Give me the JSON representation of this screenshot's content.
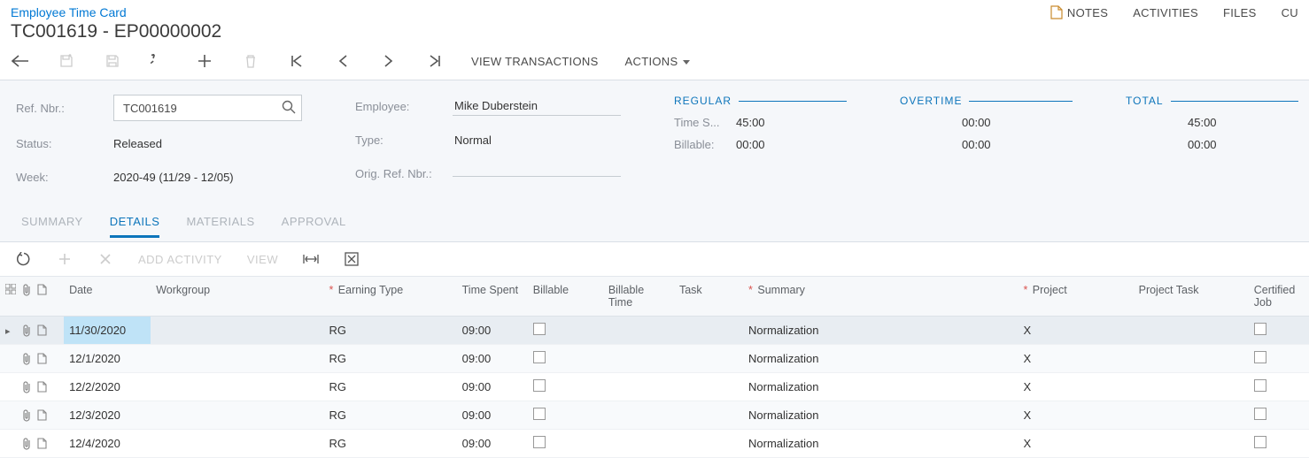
{
  "breadcrumb": "Employee Time Card",
  "title": "TC001619 - EP00000002",
  "header_actions": {
    "notes": "NOTES",
    "activities": "ACTIVITIES",
    "files": "FILES",
    "customize": "CU"
  },
  "toolbar": {
    "view_transactions": "VIEW TRANSACTIONS",
    "actions": "ACTIONS"
  },
  "form": {
    "ref_nbr_label": "Ref. Nbr.:",
    "ref_nbr_value": "TC001619",
    "status_label": "Status:",
    "status_value": "Released",
    "week_label": "Week:",
    "week_value": "2020-49 (11/29 - 12/05)",
    "employee_label": "Employee:",
    "employee_value": "Mike Duberstein",
    "type_label": "Type:",
    "type_value": "Normal",
    "orig_ref_label": "Orig. Ref. Nbr.:",
    "orig_ref_value": ""
  },
  "metrics": {
    "regular": {
      "label": "REGULAR",
      "time_spent_label": "Time S...",
      "time_spent_value": "45:00",
      "billable_label": "Billable:",
      "billable_value": "00:00"
    },
    "overtime": {
      "label": "OVERTIME",
      "time_spent_value": "00:00",
      "billable_value": "00:00"
    },
    "total": {
      "label": "TOTAL",
      "time_spent_value": "45:00",
      "billable_value": "00:00"
    }
  },
  "tabs": {
    "summary": "SUMMARY",
    "details": "DETAILS",
    "materials": "MATERIALS",
    "approval": "APPROVAL"
  },
  "grid_toolbar": {
    "add_activity": "ADD ACTIVITY",
    "view": "VIEW"
  },
  "columns": {
    "date": "Date",
    "workgroup": "Workgroup",
    "earning_type": "Earning Type",
    "time_spent": "Time Spent",
    "billable": "Billable",
    "billable_time": "Billable Time",
    "task": "Task",
    "summary": "Summary",
    "project": "Project",
    "project_task": "Project Task",
    "certified_job": "Certified Job"
  },
  "rows": [
    {
      "date": "11/30/2020",
      "earning_type": "RG",
      "time_spent": "09:00",
      "summary": "Normalization",
      "project": "X"
    },
    {
      "date": "12/1/2020",
      "earning_type": "RG",
      "time_spent": "09:00",
      "summary": "Normalization",
      "project": "X"
    },
    {
      "date": "12/2/2020",
      "earning_type": "RG",
      "time_spent": "09:00",
      "summary": "Normalization",
      "project": "X"
    },
    {
      "date": "12/3/2020",
      "earning_type": "RG",
      "time_spent": "09:00",
      "summary": "Normalization",
      "project": "X"
    },
    {
      "date": "12/4/2020",
      "earning_type": "RG",
      "time_spent": "09:00",
      "summary": "Normalization",
      "project": "X"
    }
  ]
}
